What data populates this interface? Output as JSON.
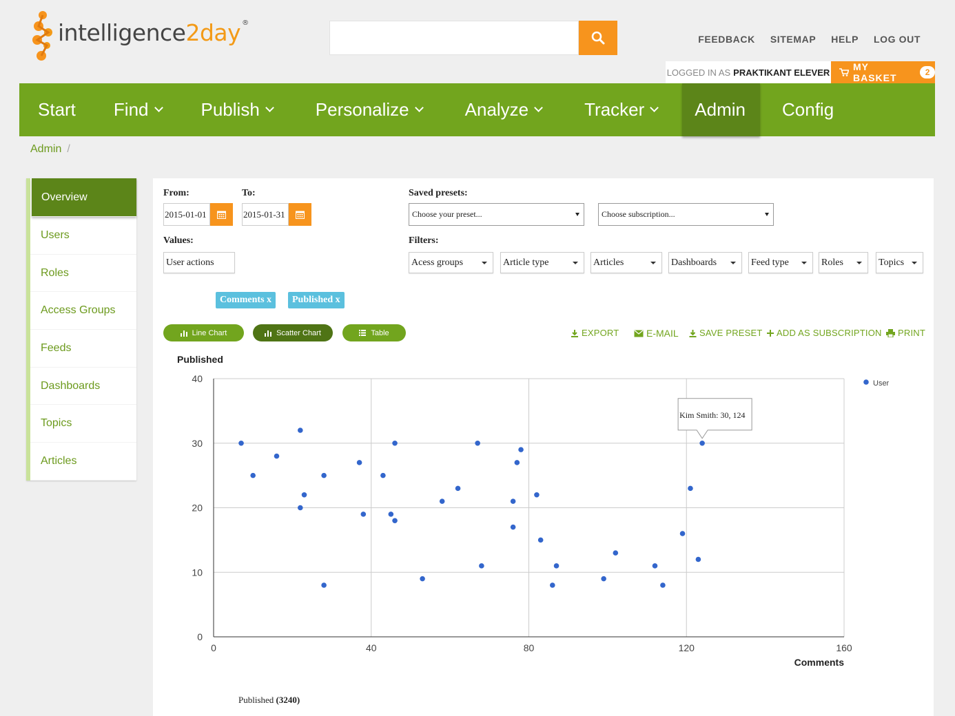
{
  "header": {
    "logo_text_main": "intelligence",
    "logo_text_two": "2",
    "logo_text_day": "day",
    "logo_reg": "®",
    "links": [
      "FEEDBACK",
      "SITEMAP",
      "HELP",
      "LOG OUT"
    ],
    "logged_in_prefix": "LOGGED IN AS",
    "logged_in_user": "PRAKTIKANT ELEVER",
    "basket_label": "MY BASKET",
    "basket_count": "2"
  },
  "nav": [
    {
      "label": "Start",
      "has_dropdown": false,
      "active": false
    },
    {
      "label": "Find",
      "has_dropdown": true,
      "active": false
    },
    {
      "label": "Publish",
      "has_dropdown": true,
      "active": false
    },
    {
      "label": "Personalize",
      "has_dropdown": true,
      "active": false
    },
    {
      "label": "Analyze",
      "has_dropdown": true,
      "active": false
    },
    {
      "label": "Tracker",
      "has_dropdown": true,
      "active": false
    },
    {
      "label": "Admin",
      "has_dropdown": false,
      "active": true
    },
    {
      "label": "Config",
      "has_dropdown": false,
      "active": false
    }
  ],
  "breadcrumb": {
    "item": "Admin",
    "separator": "/"
  },
  "sidebar": [
    {
      "label": "Overview",
      "active": true
    },
    {
      "label": "Users"
    },
    {
      "label": "Roles"
    },
    {
      "label": "Access Groups"
    },
    {
      "label": "Feeds"
    },
    {
      "label": "Dashboards"
    },
    {
      "label": "Topics"
    },
    {
      "label": "Articles"
    }
  ],
  "form": {
    "from_label": "From:",
    "from_value": "2015-01-01",
    "to_label": "To:",
    "to_value": "2015-01-31",
    "presets_label": "Saved presets:",
    "preset_select": "Choose your preset...",
    "subscription_select": "Choose subscription...",
    "values_label": "Values:",
    "values_value": "User actions",
    "filters_label": "Filters:",
    "filters": [
      "Acess groups",
      "Article type",
      "Articles",
      "Dashboards",
      "Feed type",
      "Roles",
      "Topics"
    ],
    "tags": [
      "Comments x",
      "Published x"
    ]
  },
  "chart_buttons": [
    "Line Chart",
    "Scatter Chart",
    "Table"
  ],
  "actions": [
    "EXPORT",
    "E-MAIL",
    "SAVE PRESET",
    "ADD AS SUBSCRIPTION",
    "PRINT"
  ],
  "colors": {
    "green": "#72a51e",
    "dark_green": "#5c8519",
    "orange": "#f7941d",
    "point": "#3366cc",
    "tag": "#5bc0de"
  },
  "chart_data": {
    "type": "scatter",
    "title": "Published",
    "xlabel": "Comments",
    "ylabel": "",
    "xlim": [
      0,
      160
    ],
    "ylim": [
      0,
      40
    ],
    "x_ticks": [
      0,
      40,
      80,
      120,
      160
    ],
    "y_ticks": [
      0,
      10,
      20,
      30,
      40
    ],
    "grid": true,
    "legend_position": "top-right",
    "series": [
      {
        "name": "User",
        "points": [
          [
            7,
            30
          ],
          [
            10,
            25
          ],
          [
            16,
            28
          ],
          [
            22,
            32
          ],
          [
            22,
            20
          ],
          [
            23,
            22
          ],
          [
            28,
            25
          ],
          [
            28,
            8
          ],
          [
            37,
            27
          ],
          [
            38,
            19
          ],
          [
            43,
            25
          ],
          [
            45,
            19
          ],
          [
            46,
            30
          ],
          [
            46,
            18
          ],
          [
            53,
            9
          ],
          [
            58,
            21
          ],
          [
            62,
            23
          ],
          [
            67,
            30
          ],
          [
            68,
            11
          ],
          [
            76,
            21
          ],
          [
            76,
            17
          ],
          [
            77,
            27
          ],
          [
            78,
            29
          ],
          [
            82,
            22
          ],
          [
            83,
            15
          ],
          [
            86,
            8
          ],
          [
            87,
            11
          ],
          [
            99,
            9
          ],
          [
            102,
            13
          ],
          [
            112,
            11
          ],
          [
            114,
            8
          ],
          [
            119,
            16
          ],
          [
            121,
            23
          ],
          [
            123,
            12
          ],
          [
            124,
            30
          ]
        ]
      }
    ],
    "tooltip": "Kim Smith: 30, 124"
  },
  "footer": {
    "label": "Published",
    "value": "(3240)"
  }
}
